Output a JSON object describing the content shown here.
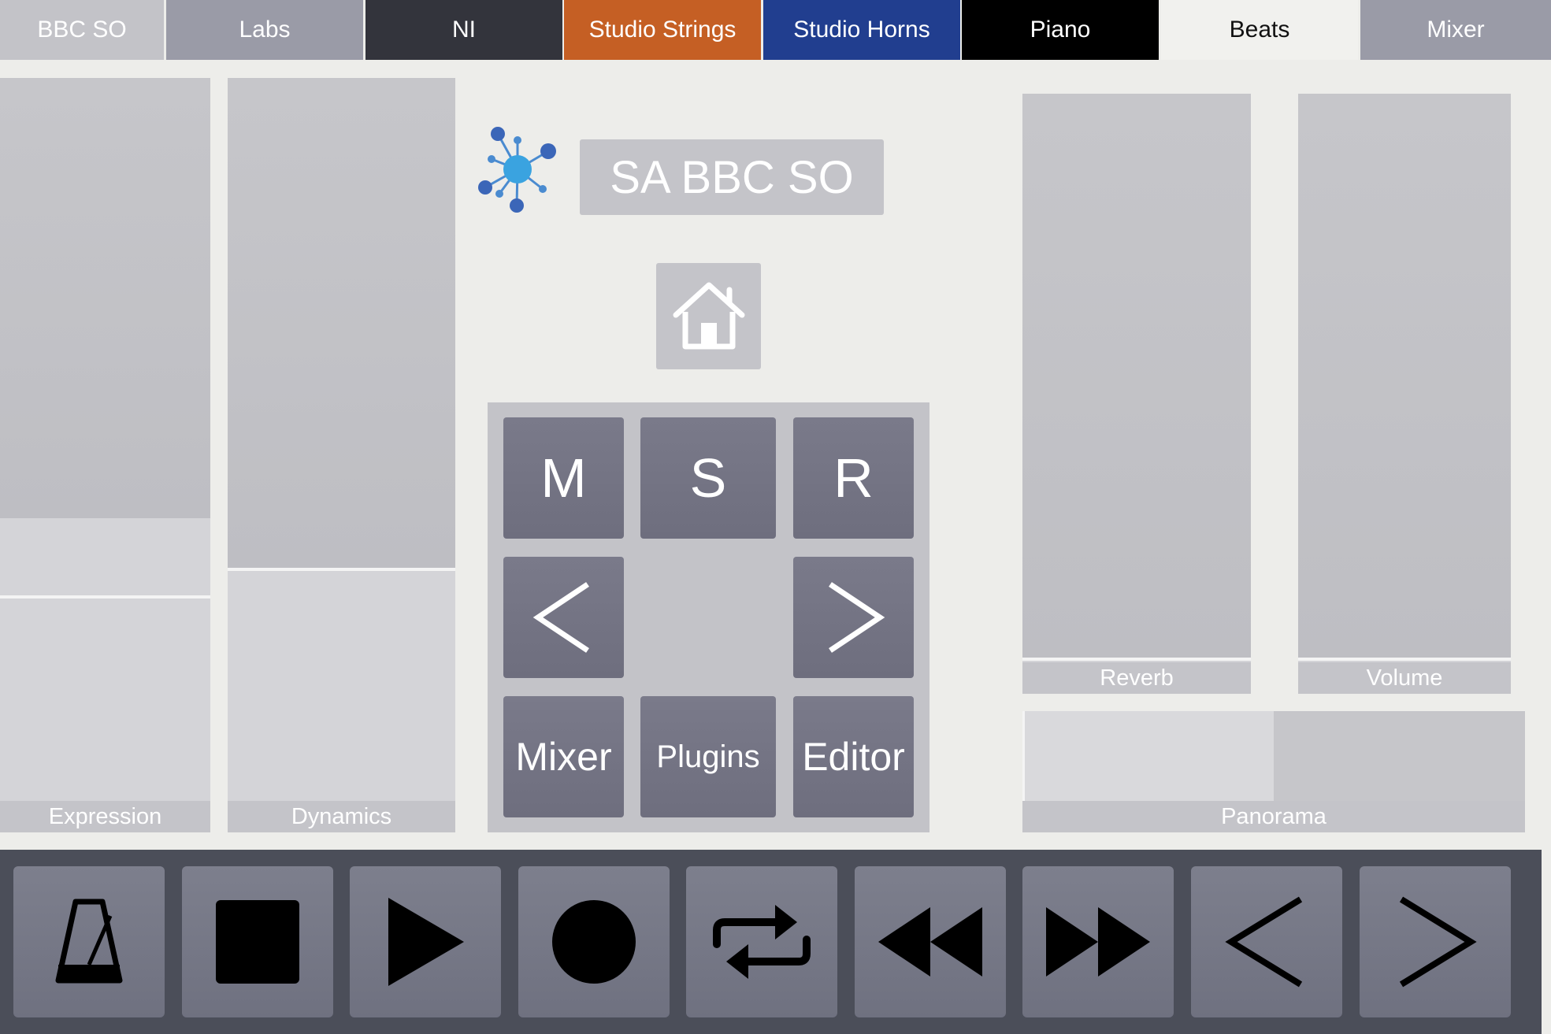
{
  "tabs": [
    {
      "label": "BBC SO",
      "bg": "#c3c3c8",
      "fg": "#ffffff"
    },
    {
      "label": "Labs",
      "bg": "#9a9ba7",
      "fg": "#ffffff"
    },
    {
      "label": "NI",
      "bg": "#33343c",
      "fg": "#ffffff"
    },
    {
      "label": "Studio Strings",
      "bg": "#c55f24",
      "fg": "#ffffff"
    },
    {
      "label": "Studio Horns",
      "bg": "#213e8f",
      "fg": "#ffffff"
    },
    {
      "label": "Piano",
      "bg": "#000000",
      "fg": "#ffffff"
    },
    {
      "label": "Beats",
      "bg": "#f1f1ee",
      "fg": "#111111"
    },
    {
      "label": "Mixer",
      "bg": "#9a9ba7",
      "fg": "#ffffff"
    }
  ],
  "faders": {
    "expression": {
      "label": "Expression",
      "level": 0.4
    },
    "dynamics": {
      "label": "Dynamics",
      "level": 0.34
    },
    "reverb": {
      "label": "Reverb",
      "level": 0.0
    },
    "volume": {
      "label": "Volume",
      "level": 0.0
    },
    "panorama": {
      "label": "Panorama",
      "level": 0.5
    }
  },
  "center": {
    "plugin_title": "SA BBC SO",
    "logo_icon": "molecule-logo-icon",
    "home_icon": "home-icon",
    "buttons": {
      "mute": "M",
      "solo": "S",
      "record": "R",
      "prev": "<",
      "next": ">",
      "mixer": "Mixer",
      "plugins": "Plugins",
      "editor": "Editor"
    }
  },
  "transport": {
    "icons": [
      "metronome-icon",
      "stop-icon",
      "play-icon",
      "record-icon",
      "loop-icon",
      "rewind-icon",
      "fast-forward-icon",
      "previous-icon",
      "next-icon"
    ]
  },
  "colors": {
    "background": "#ededea",
    "button": "#747484",
    "transport_bar": "#4b4e59"
  }
}
